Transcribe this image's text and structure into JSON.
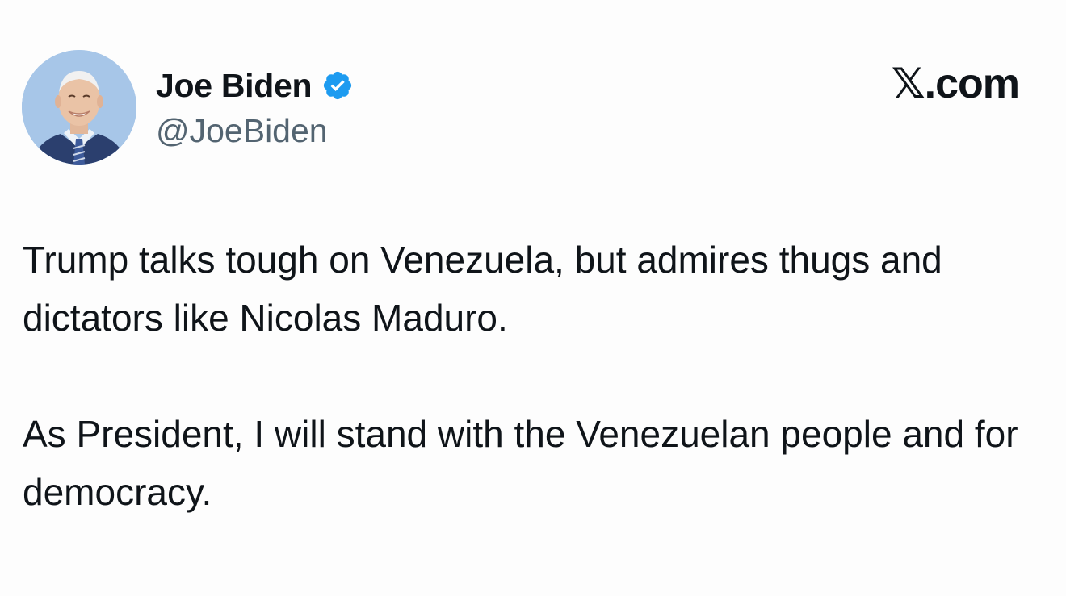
{
  "tweet": {
    "author_name": "Joe Biden",
    "author_handle": "@JoeBiden",
    "verified_icon": "verified-badge-icon",
    "brand": "𝕏.com",
    "paragraphs": [
      "Trump talks tough on Venezuela, but admires thugs and dictators like Nicolas Maduro.",
      "As President, I will stand with the Venezuelan people and for democracy."
    ]
  },
  "colors": {
    "background": "#fdfdfd",
    "text": "#0f1419",
    "secondary_text": "#536471",
    "verified": "#1d9bf0"
  }
}
